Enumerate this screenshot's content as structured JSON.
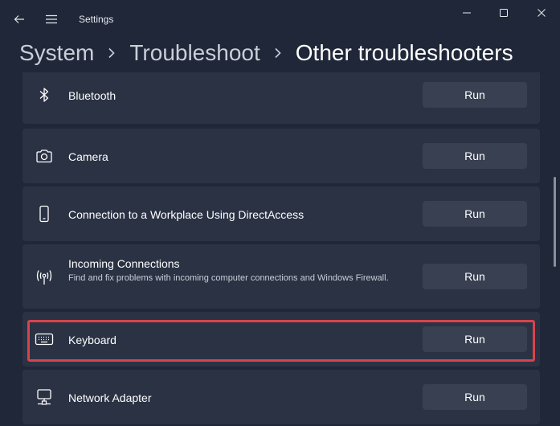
{
  "window": {
    "title": "Settings"
  },
  "breadcrumb": {
    "items": [
      "System",
      "Troubleshoot",
      "Other troubleshooters"
    ]
  },
  "troubleshooters": [
    {
      "label": "Bluetooth",
      "icon": "bluetooth-icon",
      "run_label": "Run"
    },
    {
      "label": "Camera",
      "icon": "camera-icon",
      "run_label": "Run"
    },
    {
      "label": "Connection to a Workplace Using DirectAccess",
      "icon": "phone-icon",
      "run_label": "Run"
    },
    {
      "label": "Incoming Connections",
      "description": "Find and fix problems with incoming computer connections and Windows Firewall.",
      "icon": "antenna-icon",
      "run_label": "Run"
    },
    {
      "label": "Keyboard",
      "icon": "keyboard-icon",
      "run_label": "Run"
    },
    {
      "label": "Network Adapter",
      "icon": "network-adapter-icon",
      "run_label": "Run"
    }
  ],
  "colors": {
    "background": "#1f2738",
    "card": "#2a3244",
    "button": "#384052",
    "highlight": "#d9434a"
  }
}
